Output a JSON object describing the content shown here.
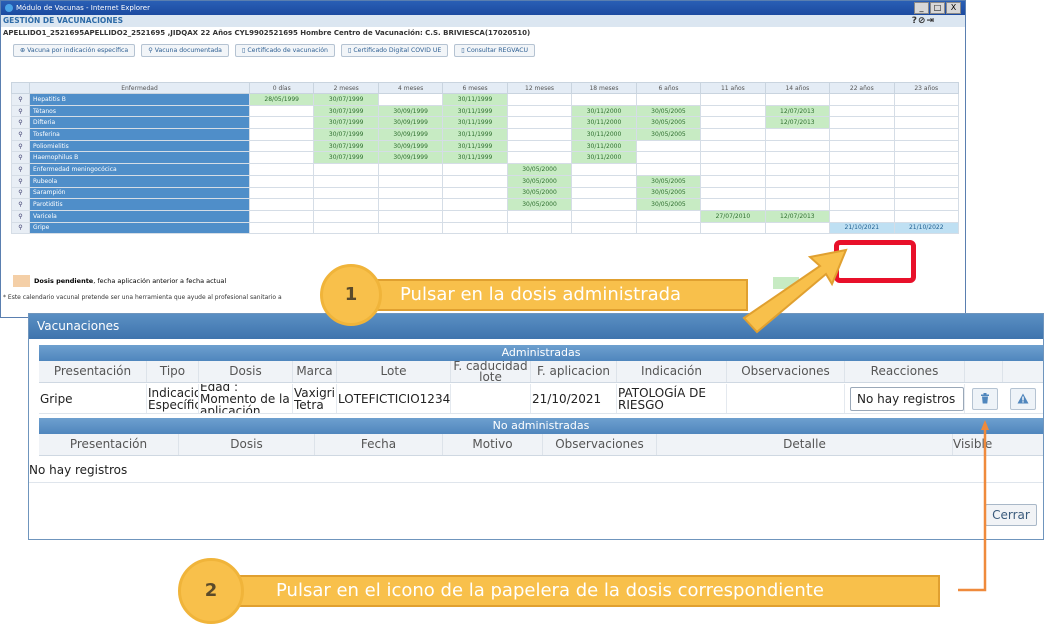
{
  "browser": {
    "title": "Módulo de Vacunas - Internet Explorer",
    "buttons": [
      "_",
      "□",
      "X"
    ]
  },
  "app": {
    "header": "GESTIÓN DE VACUNACIONES",
    "header_icons": "?⊘⇥",
    "patient": "APELLIDO1_2521695APELLIDO2_2521695 ,JIDQAX   22 Años   CYL9902521695   Hombre   Centro de Vacunación: C.S. BRIVIESCA(17020510)",
    "actions": [
      "Vacuna por indicación específica",
      "Vacuna documentada",
      "Certificado de vacunación",
      "Certificado Digital COVID UE",
      "Consultar REGVACU"
    ]
  },
  "calendar": {
    "columns": [
      "Enfermedad",
      "0 días",
      "2 meses",
      "4 meses",
      "6 meses",
      "12 meses",
      "18 meses",
      "6 años",
      "11 años",
      "14 años",
      "22 años",
      "23 años"
    ],
    "rows": [
      {
        "name": "Hepatitis B",
        "cells": [
          "28/05/1999",
          "30/07/1999",
          "",
          "30/11/1999",
          "",
          "",
          "",
          "",
          "",
          "",
          ""
        ]
      },
      {
        "name": "Tétanos",
        "cells": [
          "",
          "30/07/1999",
          "30/09/1999",
          "30/11/1999",
          "",
          "30/11/2000",
          "30/05/2005",
          "",
          "12/07/2013",
          "",
          ""
        ]
      },
      {
        "name": "Difteria",
        "cells": [
          "",
          "30/07/1999",
          "30/09/1999",
          "30/11/1999",
          "",
          "30/11/2000",
          "30/05/2005",
          "",
          "12/07/2013",
          "",
          ""
        ]
      },
      {
        "name": "Tosferina",
        "cells": [
          "",
          "30/07/1999",
          "30/09/1999",
          "30/11/1999",
          "",
          "30/11/2000",
          "30/05/2005",
          "",
          "",
          "",
          ""
        ]
      },
      {
        "name": "Poliomielitis",
        "cells": [
          "",
          "30/07/1999",
          "30/09/1999",
          "30/11/1999",
          "",
          "30/11/2000",
          "",
          "",
          "",
          "",
          ""
        ]
      },
      {
        "name": "Haemophilus B",
        "cells": [
          "",
          "30/07/1999",
          "30/09/1999",
          "30/11/1999",
          "",
          "30/11/2000",
          "",
          "",
          "",
          "",
          ""
        ]
      },
      {
        "name": "Enfermedad meningocócica",
        "cells": [
          "",
          "",
          "",
          "",
          "30/05/2000",
          "",
          "",
          "",
          "",
          "",
          ""
        ]
      },
      {
        "name": "Rubeola",
        "cells": [
          "",
          "",
          "",
          "",
          "30/05/2000",
          "",
          "30/05/2005",
          "",
          "",
          "",
          ""
        ]
      },
      {
        "name": "Sarampión",
        "cells": [
          "",
          "",
          "",
          "",
          "30/05/2000",
          "",
          "30/05/2005",
          "",
          "",
          "",
          ""
        ]
      },
      {
        "name": "Parotiditis",
        "cells": [
          "",
          "",
          "",
          "",
          "30/05/2000",
          "",
          "30/05/2005",
          "",
          "",
          "",
          ""
        ]
      },
      {
        "name": "Varicela",
        "cells": [
          "",
          "",
          "",
          "",
          "",
          "",
          "",
          "27/07/2010",
          "12/07/2013",
          "",
          ""
        ]
      },
      {
        "name": "Gripe",
        "cells": [
          "",
          "",
          "",
          "",
          "",
          "",
          "",
          "",
          "",
          "21/10/2021",
          "21/10/2022"
        ]
      }
    ],
    "legend_bold": "Dosis pendiente",
    "legend_text": ", fecha aplicación anterior a fecha actual",
    "note": "* Este calendario vacunal pretende ser una herramienta que ayude al profesional sanitario a"
  },
  "dialog": {
    "title": "Vacunaciones",
    "administradas": {
      "title": "Administradas",
      "headers": [
        "Presentación",
        "Tipo",
        "Dosis",
        "Marca",
        "Lote",
        "F. caducidad lote",
        "F. aplicacion",
        "Indicación",
        "Observaciones",
        "Reacciones"
      ],
      "row": {
        "presentacion": "Gripe",
        "tipo": "Indicacion Específica",
        "dosis": "Edad : Momento de la aplicación",
        "marca": "Vaxigrip Tetra",
        "lote": "LOTEFICTICIO1234",
        "f_caducidad": "",
        "f_aplicacion": "21/10/2021",
        "indicacion": "PATOLOGÍA DE RIESGO",
        "observaciones": "",
        "reacciones": "No hay registros"
      }
    },
    "no_administradas": {
      "title": "No administradas",
      "headers": [
        "Presentación",
        "Dosis",
        "Fecha",
        "Motivo",
        "Observaciones",
        "Detalle",
        "Visible"
      ],
      "empty": "No hay registros"
    },
    "close_label": "Cerrar"
  },
  "callouts": {
    "step1_number": "1",
    "step1_text": "Pulsar en la dosis administrada",
    "step2_number": "2",
    "step2_text": "Pulsar en el icono de la papelera de la dosis correspondiente"
  },
  "colors": {
    "callout": "#f8c04b",
    "highlight": "#e8102a",
    "connector": "#ef8a3c"
  }
}
